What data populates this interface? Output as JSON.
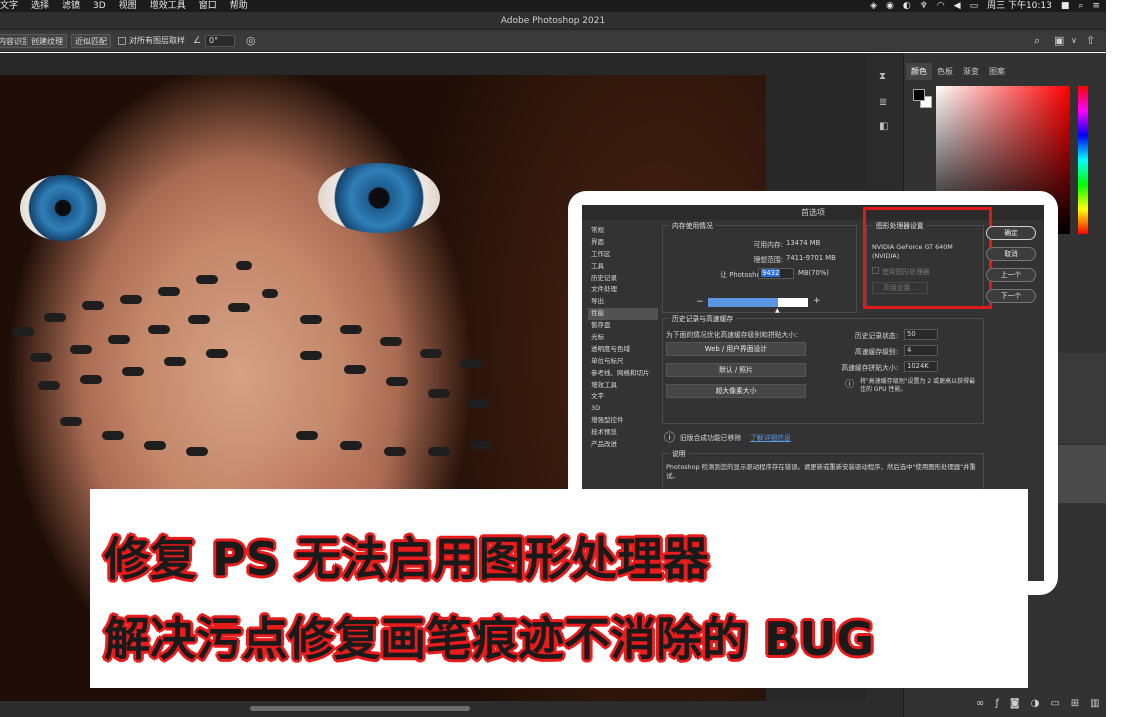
{
  "menubar": {
    "menus": [
      "文字",
      "选择",
      "滤镜",
      "3D",
      "视图",
      "增效工具",
      "窗口",
      "帮助"
    ],
    "clock": "周三 下午10:13"
  },
  "app": {
    "title": "Adobe Photoshop 2021"
  },
  "options": {
    "content_aware": "内容识别",
    "create_texture": "创建纹理",
    "proximity_match": "近似匹配",
    "sample_all_layers": "对所有图层取样",
    "angle_value": "0°"
  },
  "panels": {
    "tabs": [
      "颜色",
      "色板",
      "渐变",
      "图案"
    ],
    "active_tab": "颜色"
  },
  "preferences": {
    "title": "首选项",
    "nav": [
      "常规",
      "界面",
      "工作区",
      "工具",
      "历史记录",
      "文件处理",
      "导出",
      "性能",
      "暂存盘",
      "光标",
      "透明度与色域",
      "单位与标尺",
      "参考线、网格和切片",
      "增效工具",
      "文字",
      "3D",
      "增强型控件",
      "技术预览",
      "产品改进"
    ],
    "selected_nav": "性能",
    "memory": {
      "legend": "内存使用情况",
      "available_label": "可用内存:",
      "available_value": "13474 MB",
      "ideal_label": "理想范围:",
      "ideal_value": "7411-9701 MB",
      "let_ps_use_label": "让 Photoshop 使用:",
      "let_ps_use_value": "9432",
      "percent_text": "MB(70%)",
      "slider_fraction": 0.7,
      "minus": "−",
      "plus": "+"
    },
    "gpu": {
      "legend": "图形处理器设置",
      "card": "NVIDIA GeForce GT 640M (NVIDIA)",
      "use_gpu": "使用图形处理器",
      "advanced": "高级设置..."
    },
    "history": {
      "legend": "历史记录与高速缓存",
      "hint": "为下面的情况优化高速缓存级别和拼贴大小:",
      "btn_web": "Web / 用户界面设计",
      "btn_default": "默认 / 照片",
      "btn_huge": "超大像素大小",
      "states_label": "历史记录状态:",
      "states_value": "50",
      "cache_levels_label": "高速缓存级别:",
      "cache_levels_value": "4",
      "tile_label": "高速缓存拼贴大小:",
      "tile_value": "1024K",
      "note": "将\"高速缓存级别\"设置为 2 或更高以获得最佳的 GPU 性能。"
    },
    "legacy": {
      "text": "旧版合成功能已移除",
      "link": "了解详细信息"
    },
    "explain": {
      "legend": "说明",
      "text": "Photoshop 检测到您的显示驱动程序存在错误。请更新或重新安装驱动程序，然后选中\"使用图形处理器\"并重试。"
    },
    "buttons": {
      "ok": "确定",
      "cancel": "取消",
      "prev": "上一个",
      "next": "下一个"
    }
  },
  "caption": {
    "line1": "修复 PS 无法启用图形处理器",
    "line2": "解决污点修复画笔痕迹不消除的 BUG"
  },
  "colors": {
    "highlight_red": "#e01a1a",
    "selection_blue": "#2d6bd4"
  }
}
